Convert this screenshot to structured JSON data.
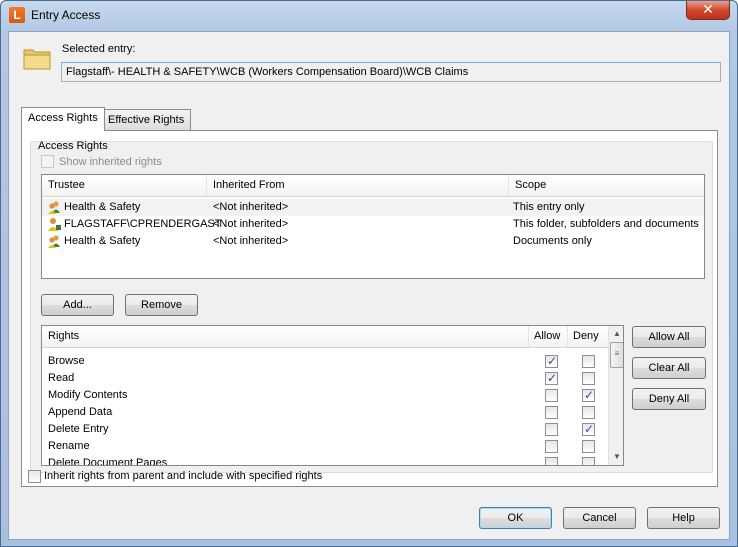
{
  "window": {
    "title": "Entry Access",
    "app_icon_letter": "L",
    "close_glyph": "✕"
  },
  "selected_entry": {
    "label": "Selected entry:",
    "path": "Flagstaff\\- HEALTH & SAFETY\\WCB (Workers Compensation Board)\\WCB Claims"
  },
  "tabs": [
    {
      "label": "Access Rights",
      "active": true
    },
    {
      "label": "Effective Rights",
      "active": false
    }
  ],
  "access_rights": {
    "group_label": "Access Rights",
    "show_inherited": {
      "label": "Show inherited rights",
      "checked": false,
      "enabled": false
    },
    "trustee_table": {
      "columns": [
        "Trustee",
        "Inherited From",
        "Scope"
      ],
      "rows": [
        {
          "trustee": "Health & Safety",
          "icon": "group-icon",
          "inherited_from": "<Not inherited>",
          "scope": "This entry only"
        },
        {
          "trustee": "FLAGSTAFF\\CPRENDERGAST",
          "icon": "user-icon",
          "inherited_from": "<Not inherited>",
          "scope": "This folder, subfolders and documents"
        },
        {
          "trustee": "Health & Safety",
          "icon": "group-icon",
          "inherited_from": "<Not inherited>",
          "scope": "Documents only"
        }
      ]
    },
    "add_button": "Add...",
    "remove_button": "Remove",
    "rights_table": {
      "columns": [
        "Rights",
        "Allow",
        "Deny"
      ],
      "rows": [
        {
          "right": "Browse",
          "allow": true,
          "deny": false
        },
        {
          "right": "Read",
          "allow": true,
          "deny": false
        },
        {
          "right": "Modify Contents",
          "allow": false,
          "deny": true
        },
        {
          "right": "Append Data",
          "allow": false,
          "deny": false
        },
        {
          "right": "Delete Entry",
          "allow": false,
          "deny": true
        },
        {
          "right": "Rename",
          "allow": false,
          "deny": false
        },
        {
          "right": "Delete Document Pages",
          "allow": false,
          "deny": false
        }
      ]
    },
    "allow_all_button": "Allow All",
    "clear_all_button": "Clear All",
    "deny_all_button": "Deny All"
  },
  "inherit_option": {
    "label": "Inherit rights from parent and include with specified rights",
    "checked": false
  },
  "footer": {
    "ok_button": "OK",
    "cancel_button": "Cancel",
    "help_button": "Help"
  },
  "colors": {
    "check_mark": "#2a4e9e",
    "title_bar": "#b2c8e4",
    "close_button": "#c03018"
  }
}
